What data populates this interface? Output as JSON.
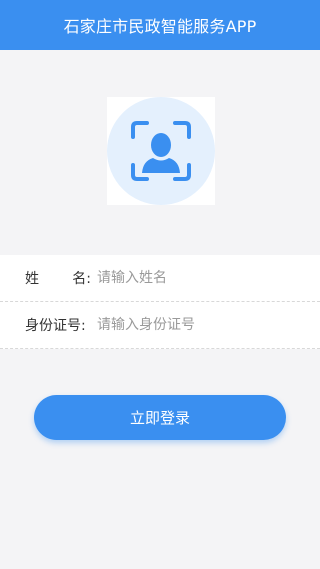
{
  "header": {
    "title": "石家庄市民政智能服务APP"
  },
  "avatar": {
    "icon": "face-scan-icon",
    "accent": "#3a8ff0",
    "circle_bg": "#e4f0fd"
  },
  "form": {
    "name": {
      "label_char1": "姓",
      "label_char2": "名:",
      "placeholder": "请输入姓名"
    },
    "id_number": {
      "label": "身份证号:",
      "placeholder": "请输入身份证号"
    }
  },
  "login": {
    "label": "立即登录"
  }
}
